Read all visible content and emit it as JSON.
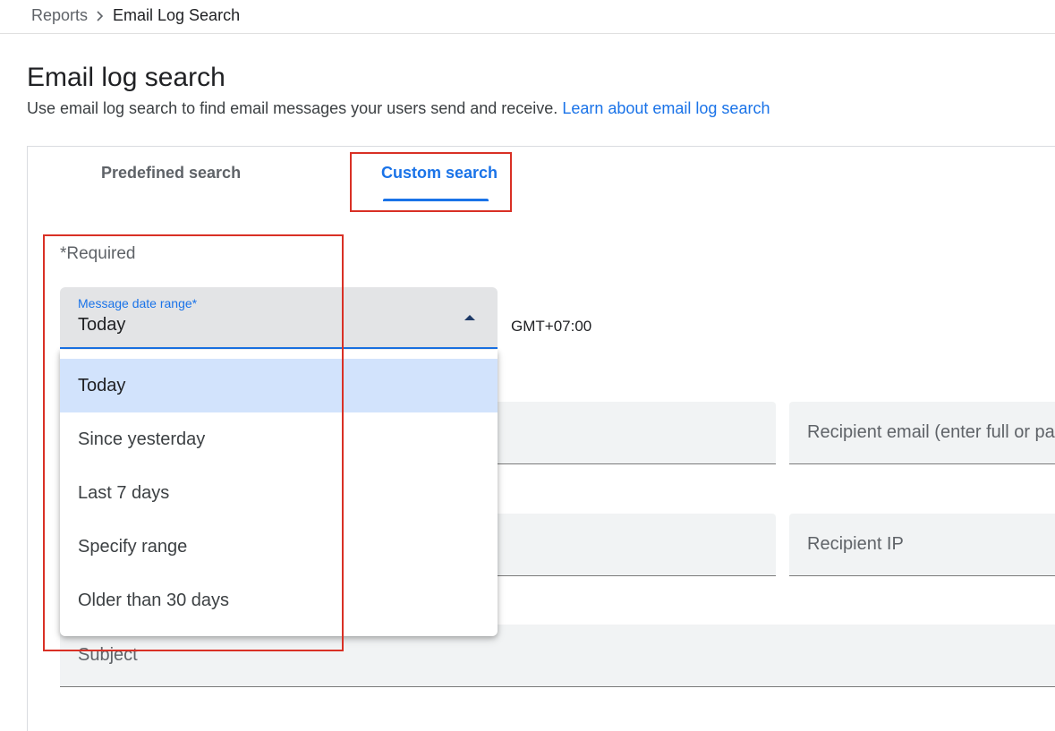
{
  "breadcrumb": {
    "parent": "Reports",
    "current": "Email Log Search"
  },
  "page": {
    "title": "Email log search",
    "description": "Use email log search to find email messages your users send and receive.",
    "learn_link": "Learn about email log search"
  },
  "tabs": [
    {
      "label": "Predefined search",
      "active": false
    },
    {
      "label": "Custom search",
      "active": true
    }
  ],
  "form": {
    "required_note": "*Required",
    "date_range": {
      "label": "Message date range*",
      "value": "Today",
      "timezone": "GMT+07:00",
      "options": [
        "Today",
        "Since yesterday",
        "Last 7 days",
        "Specify range",
        "Older than 30 days"
      ],
      "selected_index": 0
    },
    "fields": {
      "recipient_email": "Recipient email (enter full or pa",
      "recipient_ip": "Recipient IP",
      "subject": "Subject"
    }
  },
  "colors": {
    "accent": "#1a73e8",
    "highlight": "#d93025",
    "selected_option": "#d2e3fc"
  }
}
